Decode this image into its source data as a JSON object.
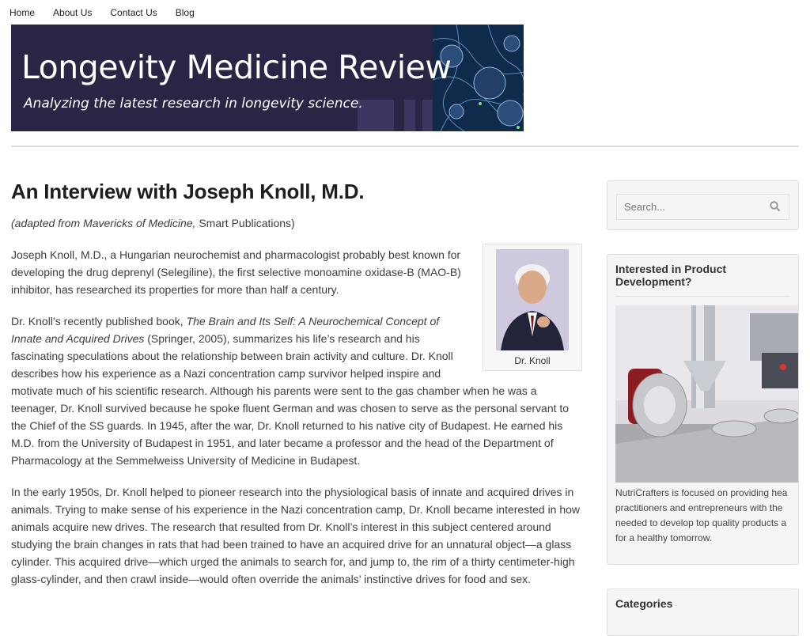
{
  "nav": {
    "items": [
      "Home",
      "About Us",
      "Contact Us",
      "Blog"
    ]
  },
  "banner": {
    "title": "Longevity Medicine Review",
    "subtitle": "Analyzing the latest research in longevity science."
  },
  "article": {
    "title": "An Interview with Joseph Knoll, M.D.",
    "source_open": "(adapted from ",
    "source_book": "Mavericks of Medicine,",
    "source_rest": " Smart Publications)",
    "figure_caption": "Dr. Knoll",
    "p1": "Joseph Knoll, M.D., a Hungarian neurochemist and pharmacologist probably best known for developing the drug deprenyl (Selegiline), the first selective monoamine oxidase-B (MAO-B) inhibitor, has researched its properties for more than half a century.",
    "p2_a": "Dr. Knoll’s recently published book, ",
    "p2_book": "The Brain and Its Self: A Neurochemical Concept of Innate and Acquired Drives",
    "p2_b": " (Springer, 2005), summarizes his life’s research and his fascinating speculations about the relationship between brain activity and culture. Dr. Knoll describes how his experience as a Nazi concentration camp survivor helped inspire and motivate much of his scientific research. Although his parents were sent to the gas chamber when he was a teenager, Dr. Knoll survived because he spoke fluent German and was chosen to serve as the personal servant to the Chief of the SS guards. In 1945, after the war, Dr. Knoll returned to his native city of Budapest. He earned his M.D. from the University of Budapest in 1951, and later became a professor and the head of the Department of Pharmacology at the Semmelweiss University of Medicine in Budapest.",
    "p3": "In the early 1950s, Dr. Knoll helped to pioneer research into the physiological basis of innate and acquired drives in animals. Trying to make sense of his experience in the Nazi concentration camp, Dr. Knoll became interested in how animals acquire new drives. The research that resulted from Dr. Knoll’s interest in this subject centered around studying the brain changes in rats that had been trained to have an acquired drive for an unnatural object—a glass cylinder. This acquired drive—which urged the animals to search for, and jump to, the rim of a thirty centimeter-high glass-cylinder, and then crawl inside—would often override the animals’ instinctive drives for food and sex."
  },
  "sidebar": {
    "search_placeholder": "Search...",
    "product_title": "Interested in Product Development?",
    "product_lines": [
      "NutriCrafters is focused on providing hea",
      "practitioners and entrepreneurs with the",
      "needed to develop top quality products a",
      "for a healthy tomorrow."
    ],
    "categories_title": "Categories"
  }
}
